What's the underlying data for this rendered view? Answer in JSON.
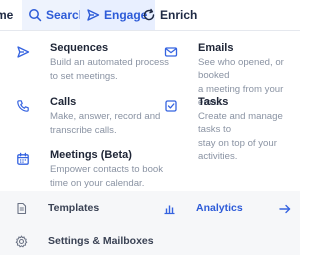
{
  "nav": {
    "home_label": "me",
    "search_label": "Search",
    "engage_label": "Engage",
    "enrich_label": "Enrich"
  },
  "menu": {
    "sequences": {
      "title": "Sequences",
      "desc1": "Build an automated process",
      "desc2": "to set meetings."
    },
    "emails": {
      "title": "Emails",
      "desc1": "See who opened, or booked",
      "desc2": "a meeting from your email."
    },
    "calls": {
      "title": "Calls",
      "desc1": "Make, answer, record and",
      "desc2": "transcribe calls."
    },
    "tasks": {
      "title": "Tasks",
      "desc1": "Create and manage tasks to",
      "desc2": "stay on top of your activities."
    },
    "meetings": {
      "title": "Meetings (Beta)",
      "desc1": "Empower contacts to book",
      "desc2": "time on your calendar."
    }
  },
  "footer": {
    "templates_label": "Templates",
    "analytics_label": "Analytics",
    "settings_label": "Settings & Mailboxes"
  },
  "colors": {
    "accent": "#2d5bd8",
    "icon": "#3563e0"
  },
  "icons": {
    "search": "search-icon",
    "engage": "send-icon",
    "enrich": "refresh-icon",
    "sequences": "send-icon",
    "emails": "mail-icon",
    "calls": "phone-icon",
    "tasks": "checkbox-icon",
    "meetings": "calendar-icon",
    "templates": "document-icon",
    "analytics": "bar-chart-icon",
    "settings": "gear-icon",
    "arrow": "arrow-right-icon"
  }
}
